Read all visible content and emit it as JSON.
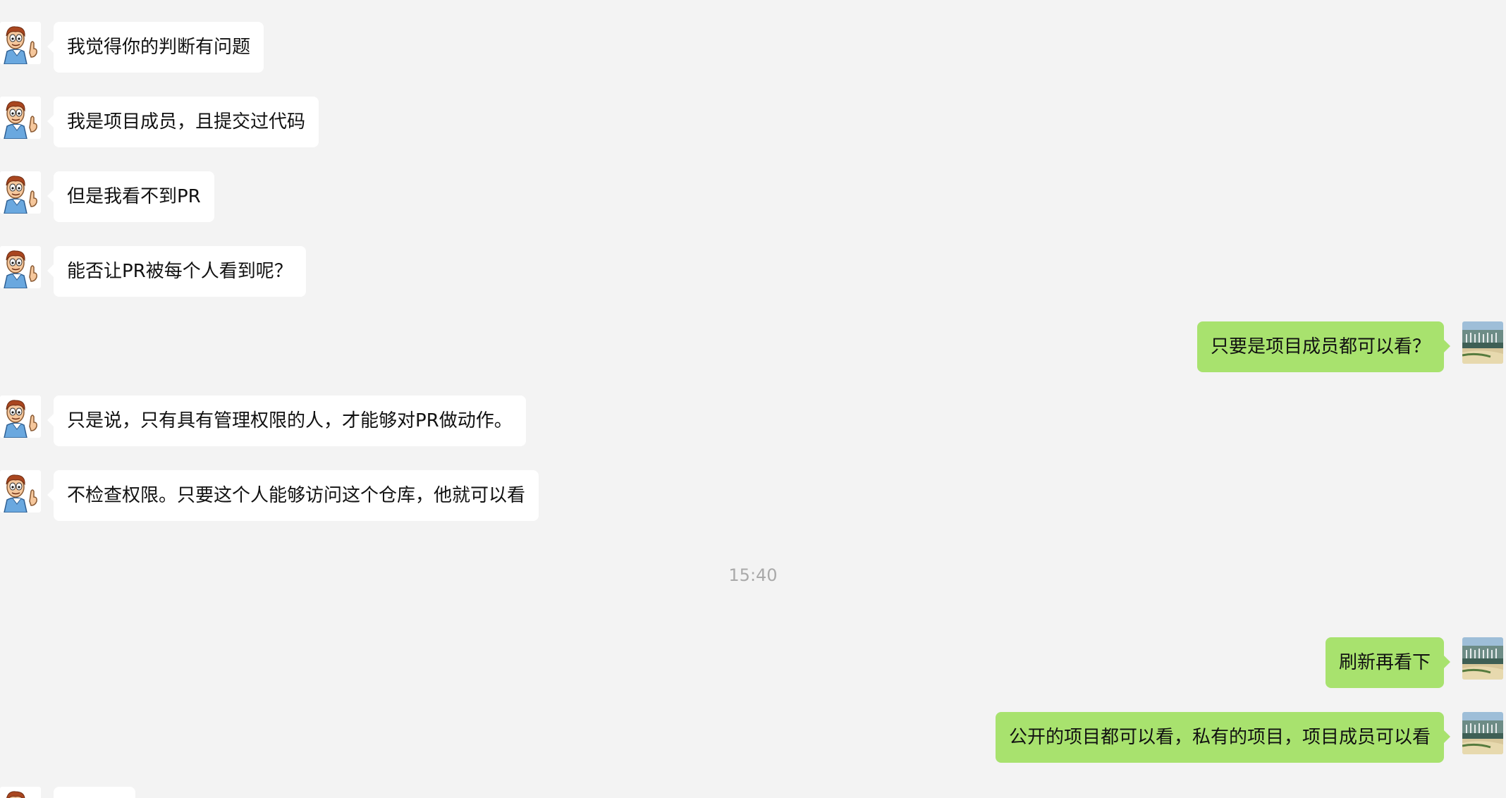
{
  "colors": {
    "background": "#f3f3f3",
    "incoming_bubble": "#ffffff",
    "outgoing_bubble": "#a8e26e",
    "timestamp": "#a9a9a9"
  },
  "avatars": {
    "contact": "cartoon-man-avatar-icon",
    "self": "landscape-photo-avatar-icon"
  },
  "messages": [
    {
      "side": "left",
      "text": "我觉得你的判断有问题"
    },
    {
      "side": "left",
      "text": "我是项目成员，且提交过代码"
    },
    {
      "side": "left",
      "text": "但是我看不到PR"
    },
    {
      "side": "left",
      "text": "能否让PR被每个人看到呢？"
    },
    {
      "side": "right",
      "text": "只要是项目成员都可以看？"
    },
    {
      "side": "left",
      "text": "只是说，只有具有管理权限的人，才能够对PR做动作。"
    },
    {
      "side": "left",
      "text": "不检查权限。只要这个人能够访问这个仓库，他就可以看"
    },
    {
      "side": "right",
      "text": "刷新再看下"
    },
    {
      "side": "right",
      "text": "公开的项目都可以看，私有的项目，项目成员可以看"
    },
    {
      "side": "left",
      "text": ""
    }
  ],
  "timestamp": "15:40"
}
